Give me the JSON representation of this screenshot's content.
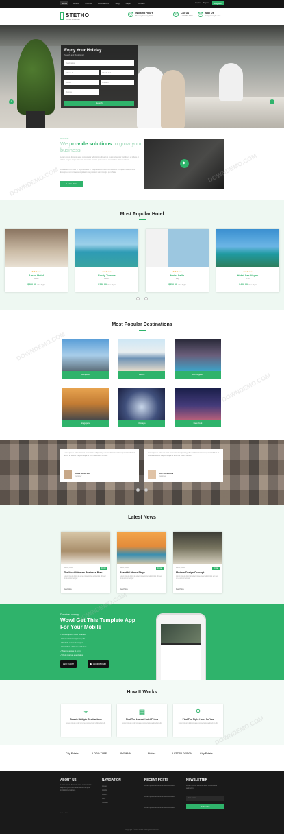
{
  "topbar": {
    "nav": [
      "Home",
      "Hotels",
      "Rooms",
      "Destinations",
      "Blog",
      "Pages",
      "Contact"
    ],
    "right": [
      "Login",
      "Sign in"
    ],
    "register": "Register"
  },
  "header": {
    "logo": "STETHO",
    "logo_sub": "HOTEL BOOKING",
    "info": [
      {
        "icon": "clock-icon",
        "title": "Working Hours",
        "sub": "Monday-Sunday 24/7"
      },
      {
        "icon": "phone-icon",
        "title": "Call Us",
        "sub": "+123 456 7890"
      },
      {
        "icon": "mail-icon",
        "title": "Mail Us",
        "sub": "info@example.com"
      }
    ]
  },
  "hero": {
    "search_title": "Enjoy Your Holiday",
    "search_sub": "Search and Book Hotel",
    "fields": [
      "Destination",
      "Check In",
      "Check Out",
      "Adults",
      "Children",
      "Rooms"
    ],
    "button": "Search"
  },
  "about": {
    "pre": "About Us",
    "title_pre": "We ",
    "title_bold": "provide solutions",
    "title_post": " to grow your business",
    "p1": "Lorem ipsum dolor sit amet consectetur adipiscing elit sed do eiusmod tempor incididunt ut labore et dolore magna aliqua. Ut enim ad minim veniam quis nostrud exercitation ullamco laboris.",
    "p2": "Duis aute irure dolor in reprehenderit in voluptate velit esse cillum dolore eu fugiat nulla pariatur. Excepteur sint occaecat cupidatat non proident sunt in culpa qui officia.",
    "button": "Learn More"
  },
  "hotels": {
    "title": "Most Popular Hotel",
    "items": [
      {
        "name": "Aman Hotel",
        "loc": "Dubai",
        "price": "$400.00",
        "per": "/ Per Night",
        "stars": "★★★☆☆"
      },
      {
        "name": "Fouty Towers",
        "loc": "Greece",
        "price": "$280.00",
        "per": "/ Per Night",
        "stars": "★★★☆☆"
      },
      {
        "name": "Hotel Italia",
        "loc": "Italy",
        "price": "$350.00",
        "per": "/ Per Night",
        "stars": "★★★☆☆"
      },
      {
        "name": "Hotel Las Vegas",
        "loc": "USA",
        "price": "$400.00",
        "per": "/ Per Night",
        "stars": "★★★☆☆"
      }
    ]
  },
  "destinations": {
    "title": "Most Popular Destinations",
    "items": [
      "Bangkok",
      "Beach",
      "Los Angeles",
      "Singapore",
      "Chicago",
      "New York"
    ]
  },
  "testimonials": [
    {
      "quote": "Lorem ipsum dolor sit amet consectetur adipiscing elit sed do eiusmod tempor incididunt ut labore et dolore magna aliqua ut enim ad minim veniam.",
      "name": "JOHN MARTINS",
      "role": "Customer"
    },
    {
      "quote": "Lorem ipsum dolor sit amet consectetur adipiscing elit sed do eiusmod tempor incididunt ut labore et dolore magna aliqua ut enim ad minim veniam.",
      "name": "KIM JOHNSON",
      "role": "Customer"
    }
  ],
  "news": {
    "title": "Latest News",
    "items": [
      {
        "title": "The Most Adverse Business Plan",
        "meta": "Admin | Hotel",
        "date": "14 Jan",
        "excerpt": "Lorem ipsum dolor sit amet consectetur adipiscing elit sed do eiusmod tempor.",
        "more": "Read More"
      },
      {
        "title": "Beautiful Home Stays",
        "meta": "Admin | Hotel",
        "date": "14 Jan",
        "excerpt": "Lorem ipsum dolor sit amet consectetur adipiscing elit sed do eiusmod tempor.",
        "more": "Read More"
      },
      {
        "title": "Modern Design Concept",
        "meta": "Admin | Hotel",
        "date": "14 Jan",
        "excerpt": "Lorem ipsum dolor sit amet consectetur adipiscing elit sed do eiusmod tempor.",
        "more": "Read More"
      }
    ]
  },
  "app": {
    "pre": "Download our app",
    "title": "Wow! Get This Templete App For Your Mobile",
    "features": [
      "✓ Lorem ipsum dolor sit amet",
      "✓ Consectetur adipiscing elit",
      "✓ Sed do eiusmod tempor",
      "✓ Incididunt ut labore et dolore",
      "✓ Magna aliqua ut enim",
      "✓ Quis nostrud exercitation"
    ],
    "appstore": "App Store",
    "googleplay": "Google play"
  },
  "how": {
    "title": "How It Works",
    "items": [
      {
        "icon": "map-pin-icon",
        "title": "Search Multiple Destinations",
        "desc": "Lorem ipsum dolor sit amet consectetur adipiscing elit."
      },
      {
        "icon": "building-icon",
        "title": "Find The Lowest Hotel Prices",
        "desc": "Lorem ipsum dolor sit amet consectetur adipiscing elit."
      },
      {
        "icon": "search-icon",
        "title": "Find The Right Hotel for You",
        "desc": "Lorem ipsum dolor sit amet consectetur adipiscing elit."
      }
    ]
  },
  "partners": [
    "City Estate",
    "LOGO TYPE",
    "IDOMAIN",
    "Pletter",
    "LETTER DESIGN",
    "City Estate"
  ],
  "footer": {
    "about_title": "ABOUT US",
    "about_text": "Lorem ipsum dolor sit amet consectetur adipiscing elit sed do eiusmod tempor incididunt ut labore.",
    "nav_title": "NAVIGATION",
    "nav": [
      "Home",
      "Hotels",
      "Rooms",
      "Blog",
      "Contact"
    ],
    "posts_title": "RECENT POSTS",
    "posts": [
      "Lorem ipsum dolor sit amet consectetur",
      "Lorem ipsum dolor sit amet consectetur",
      "Lorem ipsum dolor sit amet consectetur"
    ],
    "news_title": "NEWSLETTER",
    "news_text": "Lorem ipsum dolor sit amet consectetur adipiscing.",
    "email_ph": "Your Email",
    "subscribe": "Subscribe",
    "copyright": "Copyright © 2019 Stetho. All Rights Reserved."
  },
  "watermark": "DOWNDEMO.COM",
  "colors": {
    "accent": "#2fb36b",
    "dark": "#1a1a1a"
  }
}
